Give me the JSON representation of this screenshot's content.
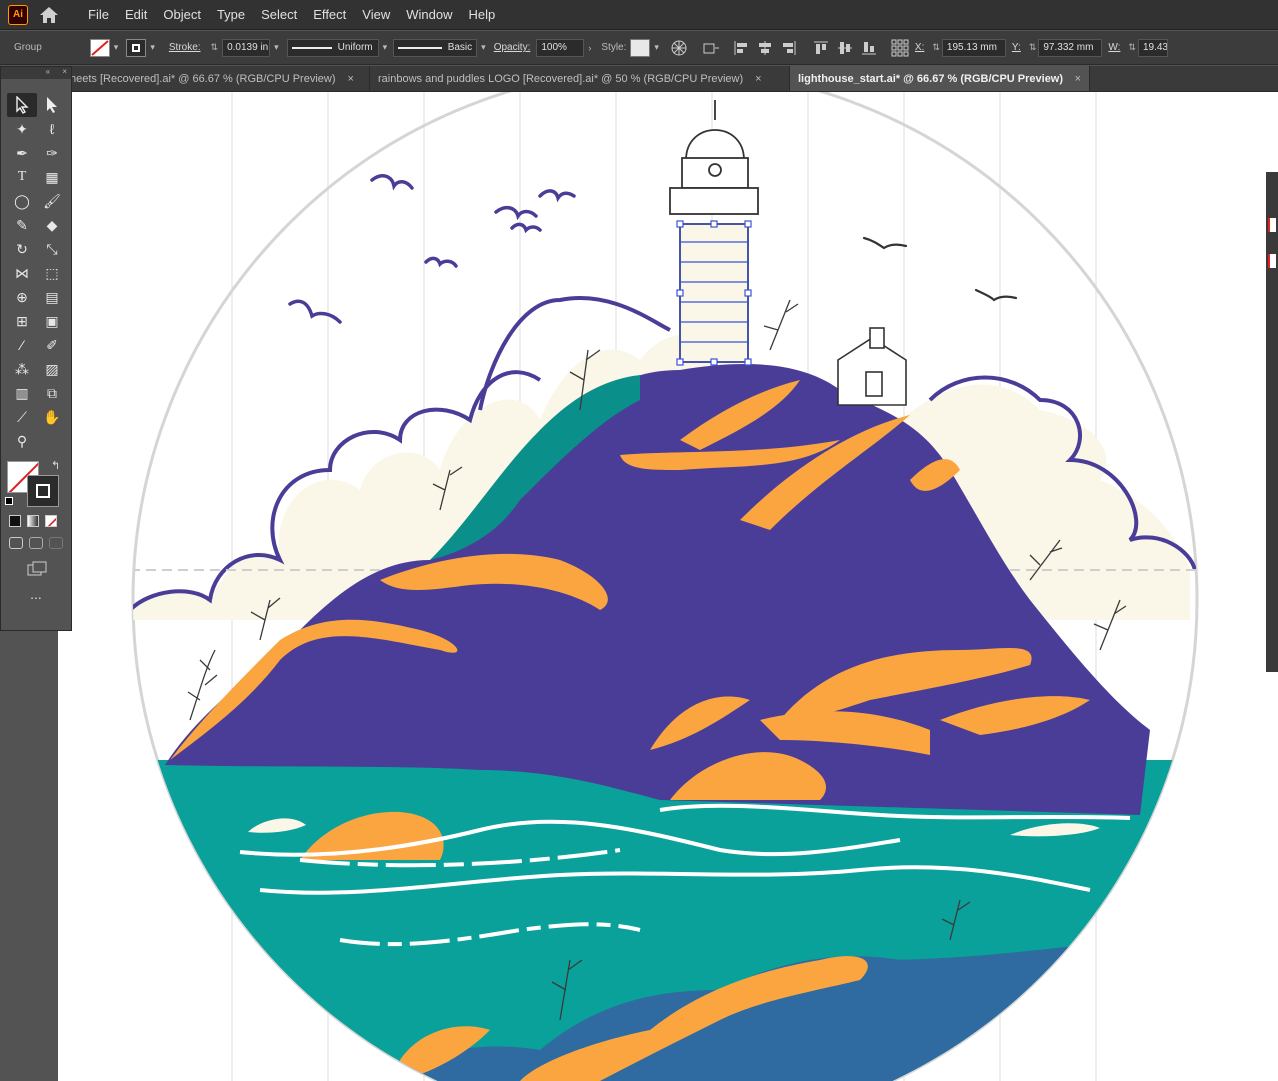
{
  "app": {
    "logo": "Ai"
  },
  "menu": [
    "File",
    "Edit",
    "Object",
    "Type",
    "Select",
    "Effect",
    "View",
    "Window",
    "Help"
  ],
  "control": {
    "selection": "Group",
    "stroke_label": "Stroke:",
    "stroke_value": "0.0139 in",
    "profile": "Uniform",
    "brush": "Basic",
    "opacity_label": "Opacity:",
    "opacity_value": "100%",
    "style_label": "Style:",
    "x_label": "X:",
    "x_value": "195.13 mm",
    "y_label": "Y:",
    "y_value": "97.332 mm",
    "w_label": "W:",
    "w_value": "19.43"
  },
  "tabs": [
    {
      "label": "heets [Recovered].ai* @ 66.67 % (RGB/CPU Preview)",
      "close": "×"
    },
    {
      "label": "rainbows and puddles LOGO [Recovered].ai* @ 50 % (RGB/CPU Preview)",
      "close": "×"
    },
    {
      "label": "lighthouse_start.ai* @ 66.67 % (RGB/CPU Preview)",
      "close": "×"
    }
  ],
  "toolbox": {
    "collapse": "«",
    "close": "×",
    "more": "..."
  },
  "colors": {
    "purple": "#4a3d98",
    "orange": "#fba541",
    "teal": "#0aa19b",
    "cream": "#faf6e8",
    "deepblue": "#2f6aa0",
    "bird": "#4a3d98"
  }
}
